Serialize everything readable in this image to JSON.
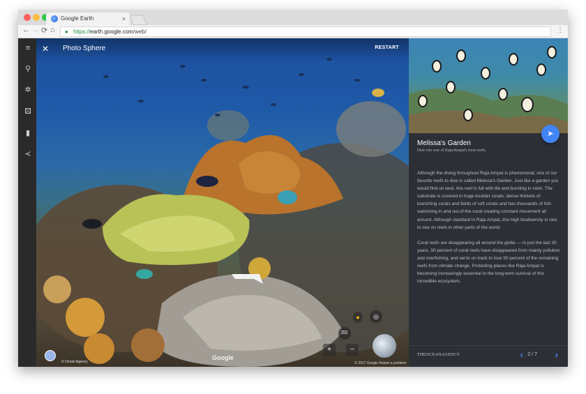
{
  "browser": {
    "tab_title": "Google Earth",
    "tab_close": "×",
    "url_scheme": "https://",
    "url_host": "earth.google.com",
    "url_path": "/web/",
    "nav_back": "←",
    "nav_forward": "→",
    "nav_reload": "⟳",
    "nav_home": "⌂",
    "menu": "⋮",
    "colors": {
      "close": "#fc605b",
      "minimize": "#fdbc40",
      "maximize": "#34c84a"
    }
  },
  "leftbar": {
    "icons": [
      "menu-icon",
      "search-icon",
      "voyager-icon",
      "dice-icon",
      "bookmark-icon",
      "share-icon"
    ],
    "glyphs": [
      "≡",
      "⚲",
      "✲",
      "⚄",
      "▮",
      "≺"
    ]
  },
  "viewer": {
    "close": "✕",
    "title": "Photo Sphere",
    "restart": "RESTART",
    "mode_2d": "2D",
    "zoom_minus": "−",
    "zoom_plus": "+",
    "contributor": "© Ocean Agency",
    "watermark": "Google",
    "legal": "© 2017 Google  Report a problem"
  },
  "panel": {
    "title": "Melissa's Garden",
    "subtitle": "Dive into one of Raja Ampat's best reefs.",
    "paragraph1": "Although the diving throughout Raja Ampat is phenomenal, one of our favorite reefs to dive is called Melissa's Garden. Just like a garden you would find on land, this reef is full with life and bursting in color. The substrate is covered in huge boulder corals, dense thickets of branching corals and fields of soft corals and has thousands of fish swimming in and out of the coral creating constant movement all around. Although standard in Raja Ampat, this high biodiversity is rare to see on reefs in other parts of the world.",
    "paragraph2": "Coral reefs are disappearing all around the globe — in just the last 30 years, 50 percent of coral reefs have disappeared from mainly pollution and overfishing, and we're on track to lose 90 percent of the remaining reefs from climate change. Protecting places like Raja Ampat is becoming increasingly essential to the long-term survival of this incredible ecosystem.",
    "logo": "THEOCEANAGENCY",
    "page": "2 / 7",
    "prev": "‹",
    "next": "›",
    "accent": "#4285f4"
  }
}
